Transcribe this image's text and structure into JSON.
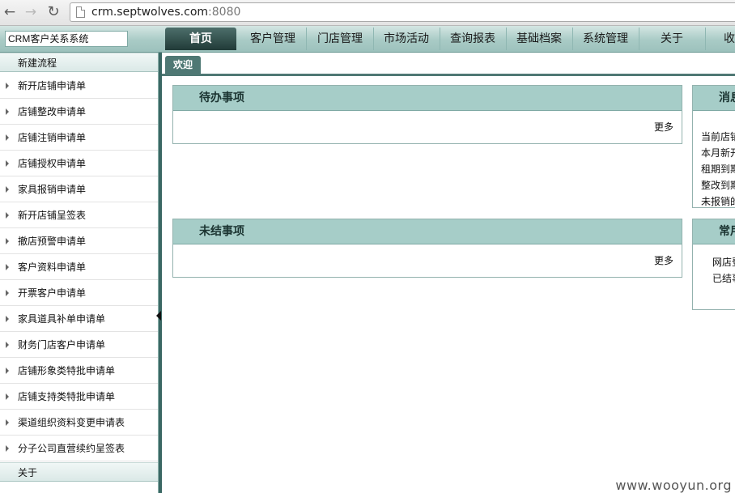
{
  "browser": {
    "url_host": "crm.septwolves.com",
    "url_port": ":8080"
  },
  "header": {
    "app_title": "CRM客户关系系统",
    "nav": [
      {
        "label": "首页"
      },
      {
        "label": "客户管理"
      },
      {
        "label": "门店管理"
      },
      {
        "label": "市场活动"
      },
      {
        "label": "查询报表"
      },
      {
        "label": "基础档案"
      },
      {
        "label": "系统管理"
      },
      {
        "label": "关于"
      },
      {
        "label": "收"
      }
    ]
  },
  "sidebar": {
    "section_new": "新建流程",
    "items": [
      {
        "label": "新开店铺申请单"
      },
      {
        "label": "店铺整改申请单"
      },
      {
        "label": "店铺注销申请单"
      },
      {
        "label": "店铺授权申请单"
      },
      {
        "label": "家具报销申请单"
      },
      {
        "label": "新开店铺呈签表"
      },
      {
        "label": "撤店预警申请单"
      },
      {
        "label": "客户资料申请单"
      },
      {
        "label": "开票客户申请单"
      },
      {
        "label": "家具道具补单申请单"
      },
      {
        "label": "财务门店客户申请单"
      },
      {
        "label": "店铺形象类特批申请单"
      },
      {
        "label": "店铺支持类特批申请单"
      },
      {
        "label": "渠道组织资料变更申请表"
      },
      {
        "label": "分子公司直营续约呈签表"
      }
    ],
    "section_about": "关于"
  },
  "tabs": {
    "welcome": "欢迎"
  },
  "panels": {
    "todo": {
      "title": "待办事项",
      "more": "更多"
    },
    "pending": {
      "title": "未结事项",
      "more": "更多"
    },
    "messages": {
      "title": "消息",
      "lines": [
        "当前店铺",
        "本月新开",
        "租期到期",
        "整改到期",
        "未报销的"
      ]
    },
    "common": {
      "title": "常用",
      "lines": [
        "网店登",
        "已结事"
      ]
    }
  },
  "watermark": "www.wooyun.org"
}
